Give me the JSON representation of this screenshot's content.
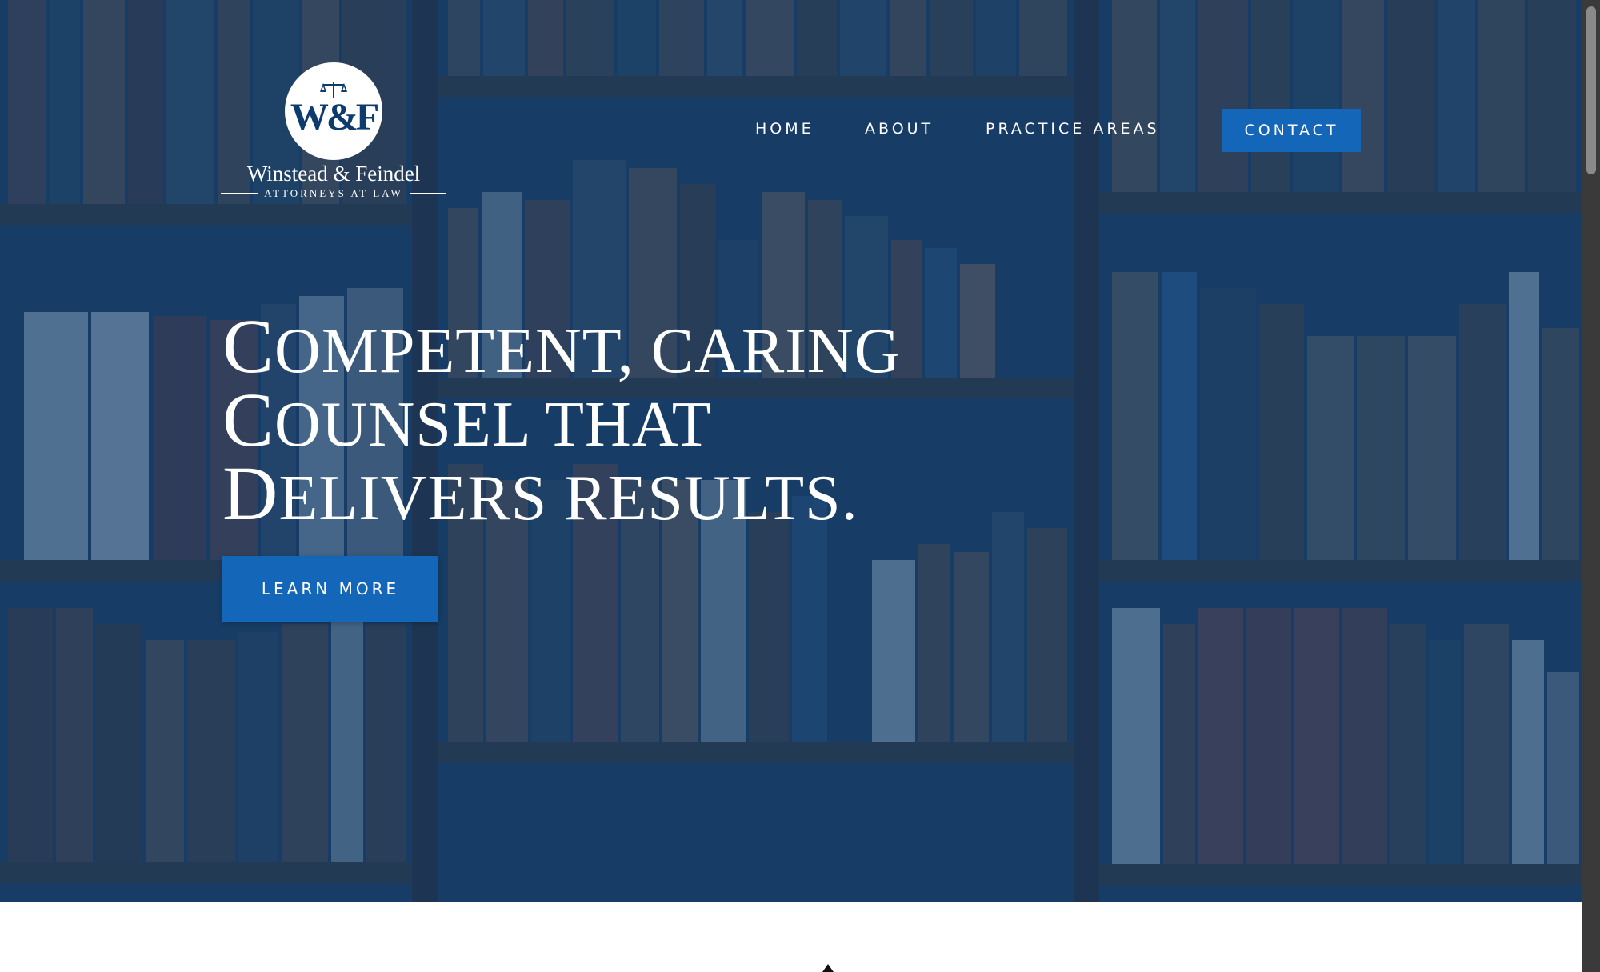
{
  "logo": {
    "monogram": "W&F",
    "firm_name": "Winstead & Feindel",
    "tagline": "ATTORNEYS AT LAW"
  },
  "nav": {
    "items": [
      {
        "label": "HOME"
      },
      {
        "label": "ABOUT"
      },
      {
        "label": "PRACTICE AREAS"
      }
    ],
    "cta_label": "CONTACT"
  },
  "hero": {
    "headline_lines": [
      "Competent, caring",
      "counsel that",
      "delivers results."
    ],
    "button_label": "LEARN MORE"
  },
  "colors": {
    "overlay": "#0c3c70",
    "accent_button": "#1466b8",
    "text_on_dark": "#ffffff"
  },
  "icons": {
    "logo_scale": "scales-of-justice-icon",
    "below_fold": "caret-up-icon"
  }
}
